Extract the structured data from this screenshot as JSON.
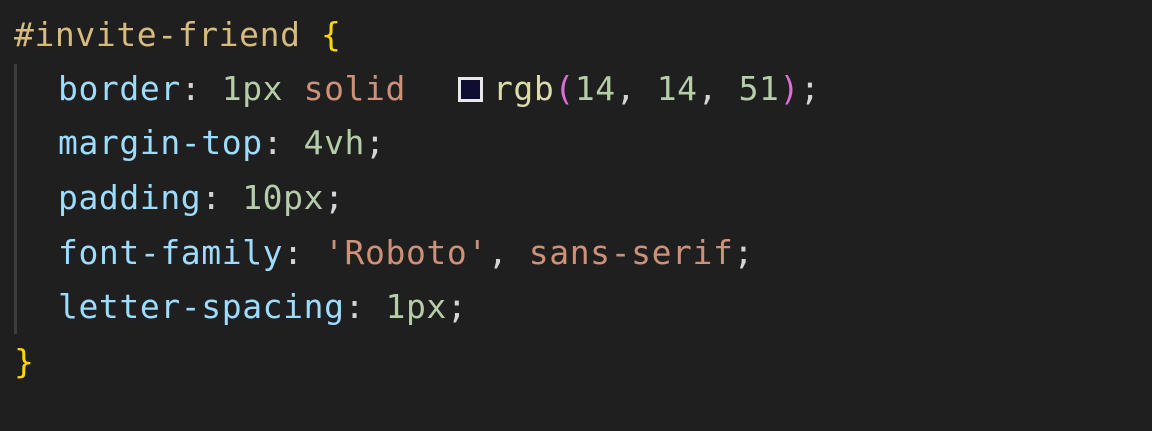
{
  "colors": {
    "background": "#1f1f1f",
    "selector": "#d7ba7d",
    "brace": "#ffd700",
    "property": "#9cdcfe",
    "number": "#b5cea8",
    "string": "#ce9178",
    "function": "#dcdcaa",
    "paren": "#da70d6",
    "punctuation": "#d4d4d4",
    "color_swatch": "rgb(14, 14, 51)"
  },
  "code": {
    "selector": "#invite-friend",
    "open_brace": "{",
    "close_brace": "}",
    "decl_border": {
      "property": "border",
      "colon": ":",
      "value_width": "1px",
      "value_style": "solid",
      "func": "rgb",
      "open_paren": "(",
      "r": "14",
      "comma1": ",",
      "g": "14",
      "comma2": ",",
      "b": "51",
      "close_paren": ")",
      "semicolon": ";"
    },
    "decl_margin": {
      "property": "margin-top",
      "colon": ":",
      "value": "4vh",
      "semicolon": ";"
    },
    "decl_padding": {
      "property": "padding",
      "colon": ":",
      "value": "10px",
      "semicolon": ";"
    },
    "decl_font": {
      "property": "font-family",
      "colon": ":",
      "value_primary": "'Roboto'",
      "comma": ",",
      "value_fallback": "sans-serif",
      "semicolon": ";"
    },
    "decl_letter": {
      "property": "letter-spacing",
      "colon": ":",
      "value": "1px",
      "semicolon": ";"
    }
  }
}
